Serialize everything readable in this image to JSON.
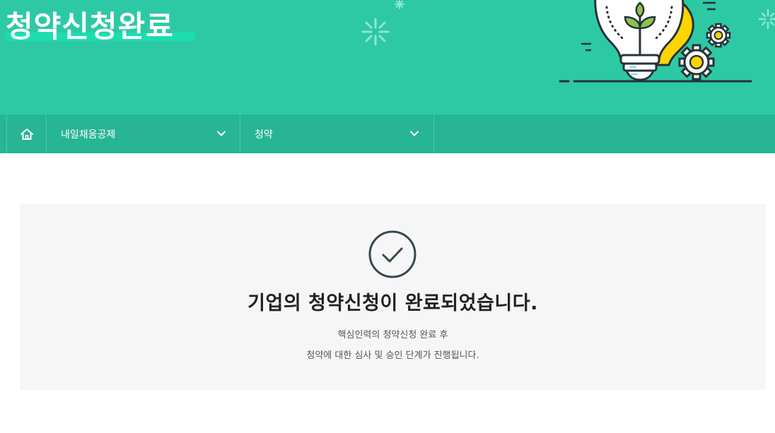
{
  "hero": {
    "title": "청약신청완료"
  },
  "breadcrumb": {
    "home_icon": "home-icon",
    "level1_label": "내일채움공제",
    "level2_label": "청약",
    "chevron_icon": "chevron-down-icon"
  },
  "completion": {
    "icon": "check-circle-icon",
    "title": "기업의 청약신청이 완료되었습니다.",
    "desc_line1": "핵심인력의 청약신청 완료 후",
    "desc_line2": "청약에 대한 심사 및 승인 단계가 진행됩니다."
  },
  "colors": {
    "hero_bg": "#2dc9a5",
    "nav_bg": "#27b593",
    "box_bg": "#f6f6f6",
    "bulb_accent": "#ffd400"
  }
}
